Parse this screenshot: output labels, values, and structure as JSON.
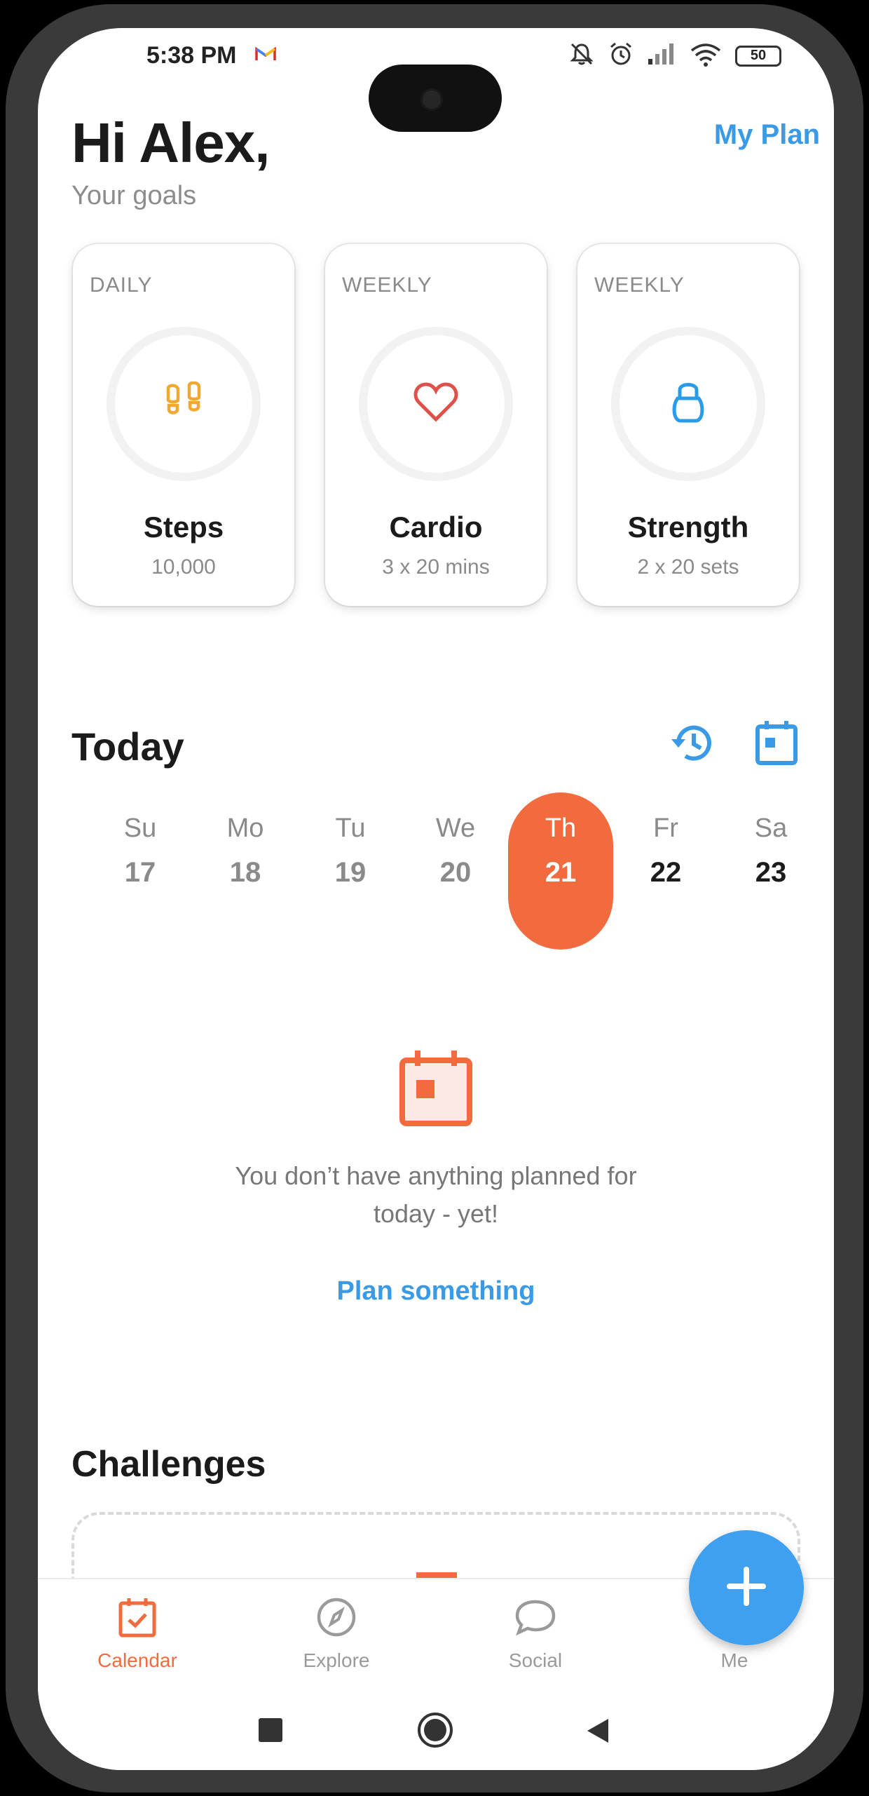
{
  "status_bar": {
    "time": "5:38 PM",
    "battery": "50",
    "icons": [
      "gmail-icon",
      "mute-icon",
      "alarm-icon",
      "signal-icon",
      "wifi-icon",
      "battery-icon"
    ]
  },
  "header": {
    "greeting": "Hi Alex,",
    "subtitle": "Your goals",
    "my_plan_label": "My Plan"
  },
  "goals": [
    {
      "period": "DAILY",
      "name": "Steps",
      "target": "10,000",
      "icon": "footprints-icon",
      "color": "#f0a830"
    },
    {
      "period": "WEEKLY",
      "name": "Cardio",
      "target": "3 x 20 mins",
      "icon": "heart-icon",
      "color": "#e0504a"
    },
    {
      "period": "WEEKLY",
      "name": "Strength",
      "target": "2 x 20 sets",
      "icon": "kettlebell-icon",
      "color": "#2a9be8"
    }
  ],
  "today": {
    "title": "Today",
    "days": [
      {
        "name": "Su",
        "num": "17"
      },
      {
        "name": "Mo",
        "num": "18"
      },
      {
        "name": "Tu",
        "num": "19"
      },
      {
        "name": "We",
        "num": "20"
      },
      {
        "name": "Th",
        "num": "21"
      },
      {
        "name": "Fr",
        "num": "22"
      },
      {
        "name": "Sa",
        "num": "23"
      }
    ],
    "selected_index": 4
  },
  "empty_state": {
    "line1": "You don’t have anything planned for",
    "line2": "today - yet!",
    "link": "Plan something"
  },
  "challenges": {
    "title": "Challenges"
  },
  "bottom_nav": [
    {
      "label": "Calendar",
      "icon": "calendar-icon",
      "active": true
    },
    {
      "label": "Explore",
      "icon": "compass-icon",
      "active": false
    },
    {
      "label": "Social",
      "icon": "chat-bubble-icon",
      "active": false
    },
    {
      "label": "Me",
      "icon": "profile-icon",
      "active": false
    }
  ],
  "colors": {
    "accent_orange": "#f26b3e",
    "accent_blue": "#3a9ae6",
    "fab_blue": "#3ea0ee"
  }
}
